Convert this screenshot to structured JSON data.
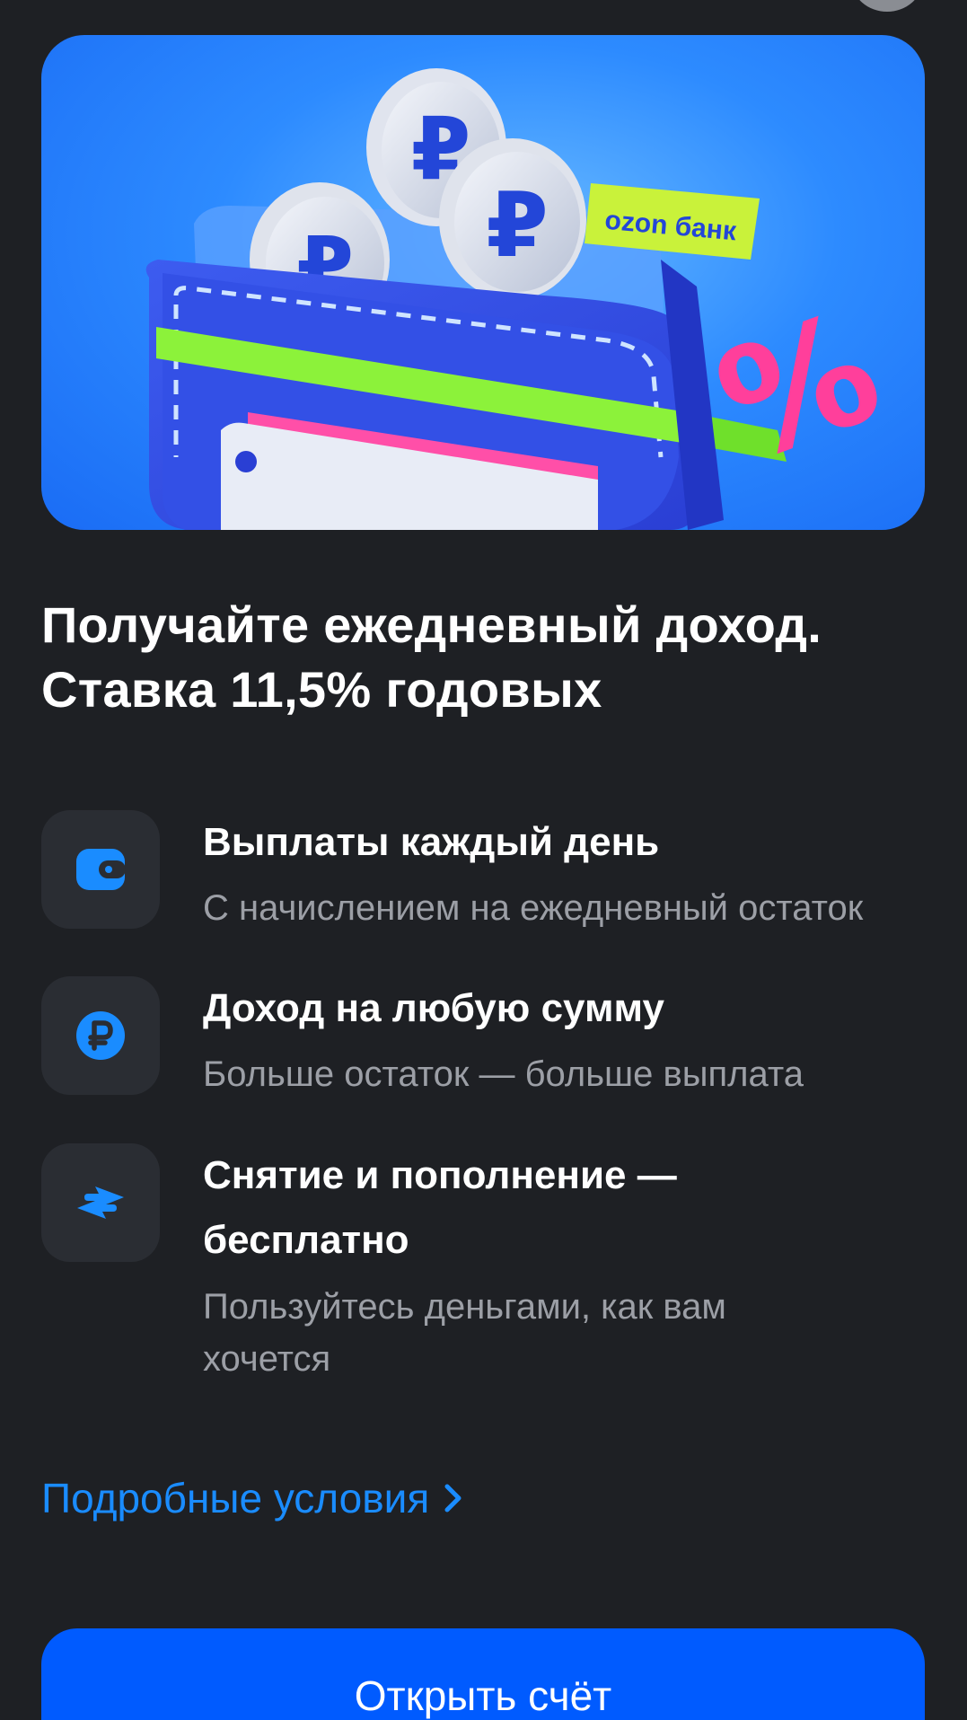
{
  "hero": {
    "image_alt": "wallet-with-ruble-coins-illustration",
    "tag_text": "ozon банк"
  },
  "headline": {
    "line1": "Получайте ежедневный доход.",
    "line2": "Ставка 11,5% годовых"
  },
  "features": [
    {
      "icon": "wallet-icon",
      "title": "Выплаты каждый день",
      "subtitle": "С начислением на ежедневный остаток"
    },
    {
      "icon": "ruble-icon",
      "title": "Доход на любую сумму",
      "subtitle": "Больше остаток — больше выплата"
    },
    {
      "icon": "transfer-arrows-icon",
      "title_line1": "Снятие и пополнение —",
      "title_line2": "бесплатно",
      "subtitle_line1": "Пользуйтесь деньгами, как вам",
      "subtitle_line2": "хочется"
    }
  ],
  "details_link": {
    "label": "Подробные условия"
  },
  "cta": {
    "label": "Открыть счёт"
  },
  "colors": {
    "background": "#1e2024",
    "accent": "#005bff",
    "link": "#1a8cff",
    "icon_blue": "#1a8cff",
    "icon_box": "#2a2d33",
    "secondary_text": "#9c9fa6"
  }
}
